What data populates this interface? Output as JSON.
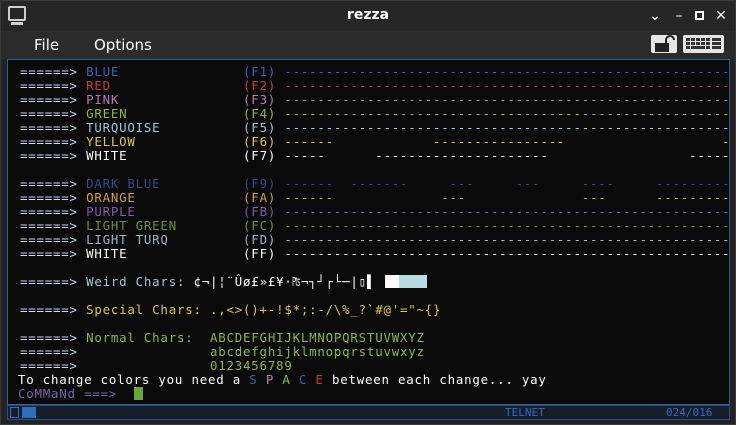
{
  "window": {
    "title": "rezza"
  },
  "menu": {
    "file": "File",
    "options": "Options"
  },
  "colors": {
    "arrow": "#c8d8ff",
    "blue": "#3d5fb5",
    "red": "#c53b3b",
    "pink": "#b97ab8",
    "green": "#8fb83c",
    "turquoise": "#9ec9d6",
    "yellow": "#e0c93c",
    "white": "#ffffff",
    "dark_blue": "#2f4a8c",
    "orange": "#d4a23a",
    "purple": "#7d5fb0",
    "light_green": "#6e8f2e",
    "light_turq": "#a0b4c8"
  },
  "terminal": {
    "lines": [
      {
        "arrow": "======>",
        "name": "BLUE",
        "key": "(F1)",
        "bar": "----------------------------------------------------------------------------",
        "color": "#3d5fb5"
      },
      {
        "arrow": "======>",
        "name": "RED",
        "key": "(F2)",
        "bar": "----------------------------------------------------------------------------",
        "color": "#c53b3b"
      },
      {
        "arrow": "======>",
        "name": "PINK",
        "key": "(F3)",
        "bar": "----------------------------------------------------------------------------",
        "color": "#b97ab8"
      },
      {
        "arrow": "======>",
        "name": "GREEN",
        "key": "(F4)",
        "bar": "----------------------------------------------------------------------------",
        "color": "#8fb83c"
      },
      {
        "arrow": "======>",
        "name": "TURQUOISE",
        "key": "(F5)",
        "bar": "----------------------------------------------------------------------------",
        "color": "#9ec9d6"
      },
      {
        "arrow": "======>",
        "name": "YELLOW",
        "key": "(F6)",
        "bar": "------            ----------------                   ----",
        "color": "#e0c93c"
      },
      {
        "arrow": "======>",
        "name": "WHITE",
        "key": "(F7)",
        "bar": "-----      ---------------------                 ----------",
        "color": "#ffffff"
      },
      {
        "arrow": "======>",
        "name": "DARK BLUE",
        "key": "(F9)",
        "bar": "------  -------     ---     ---     ----     -----------",
        "color": "#2f4a8c"
      },
      {
        "arrow": "======>",
        "name": "ORANGE",
        "key": "(FA)",
        "bar": "------             ---              ---      -----------",
        "color": "#d4a23a"
      },
      {
        "arrow": "======>",
        "name": "PURPLE",
        "key": "(FB)",
        "bar": "----------------------------------------------------------------------------",
        "color": "#7d5fb0"
      },
      {
        "arrow": "======>",
        "name": "LIGHT GREEN",
        "key": "(FC)",
        "bar": "----------------------------------------------------------------------------",
        "color": "#6e8f2e"
      },
      {
        "arrow": "======>",
        "name": "LIGHT TURQ",
        "key": "(FD)",
        "bar": "----------------------------------------------------------------------------",
        "color": "#a0b4c8"
      },
      {
        "arrow": "======>",
        "name": "WHITE",
        "key": "(FF)",
        "bar": "----------------------------------------------------------------------------",
        "color": "#ffffff"
      }
    ],
    "weird": {
      "arrow": "======>",
      "label": "Weird Chars:",
      "chars": "¢¬|¦¨Ûø£»£¥·₧¬┐┘┌└─|▯▌"
    },
    "special": {
      "arrow": "======>",
      "label": "Special Chars:",
      "chars": ".,<>()+-!$*;:-/\\%_?`#@'=\"~{}"
    },
    "normal": {
      "arrow": "======>",
      "label": "Normal Chars:",
      "upper": "ABCDEFGHIJKLMNOPQRSTUVWXYZ",
      "lower": "abcdefghijklmnopqrstuvwxyz",
      "digits": "0123456789"
    },
    "info": {
      "prefix": "To change colors you need a",
      "space": [
        "S",
        "P",
        "A",
        "C",
        "E"
      ],
      "suffix": "between each change... yay"
    },
    "prompt": "CoMMaNd ===>"
  },
  "status": {
    "mode": "TELNET",
    "position": "024/016"
  }
}
